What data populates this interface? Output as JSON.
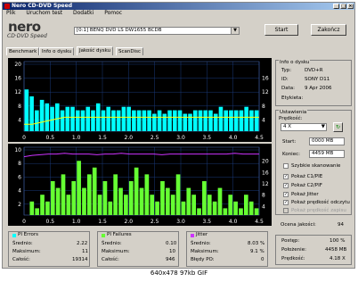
{
  "window": {
    "title": "Nero CD-DVD Speed",
    "minimize": "_",
    "maximize": "□",
    "close": "×"
  },
  "menu": [
    "Plik",
    "Uruchom test",
    "Dodatki",
    "Pomoc"
  ],
  "logo": {
    "brand": "nero",
    "product": "CD·DVD Speed"
  },
  "drive": {
    "selected": "[0:1]  BENQ DVD LS DW1655 BCDB",
    "arrow": "▼"
  },
  "buttons": {
    "start": "Start",
    "close": "Zakończ"
  },
  "tabs": [
    "Benchmark",
    "Info o dysku",
    "Jakość dysku",
    "ScanDisc"
  ],
  "chart_data": [
    {
      "type": "bar",
      "title": "",
      "x_ticks": [
        "0",
        "0.5",
        "1.0",
        "1.5",
        "2.0",
        "2.5",
        "3.0",
        "3.5",
        "4.0",
        "4.5"
      ],
      "y_ticks_left": [
        "20",
        "16",
        "12",
        "8",
        "4"
      ],
      "y_ticks_right": [
        "16",
        "12",
        "8",
        "4"
      ],
      "xlim": [
        0,
        4.5
      ],
      "ylim": [
        0,
        20
      ],
      "series": [
        {
          "name": "PI Errors",
          "color": "#00ffff",
          "style": "bars",
          "values": [
            12,
            10,
            6,
            9,
            8,
            7,
            8,
            6,
            7,
            7,
            6,
            6,
            7,
            6,
            8,
            6,
            7,
            6,
            6,
            7,
            7,
            6,
            6,
            6,
            6,
            5,
            6,
            5,
            6,
            6,
            6,
            5,
            5,
            6,
            6,
            6,
            6,
            5,
            7,
            6,
            6,
            6,
            6,
            7,
            6,
            6
          ]
        },
        {
          "name": "Read speed",
          "color": "#ffff00",
          "style": "line",
          "values": [
            2.0,
            2.0,
            2.5,
            3.0,
            3.5,
            4.0,
            4.0,
            4.0,
            4.0,
            4.0,
            4.0,
            4.0,
            4.0,
            4.0,
            4.0,
            4.0,
            4.0,
            4.0,
            4.0,
            4.0,
            4.0,
            4.0,
            4.0,
            4.0,
            4.0,
            4.0,
            4.0,
            4.0,
            4.0,
            4.0
          ]
        }
      ]
    },
    {
      "type": "bar",
      "title": "",
      "x_ticks": [
        "0",
        "0.5",
        "1.0",
        "1.5",
        "2.0",
        "2.5",
        "3.0",
        "3.5",
        "4.0",
        "4.5"
      ],
      "y_ticks_left": [
        "10",
        "8",
        "6",
        "4",
        "2"
      ],
      "y_ticks_right": [
        "20",
        "16",
        "12",
        "8",
        "4"
      ],
      "xlim": [
        0,
        4.5
      ],
      "ylim": [
        0,
        10
      ],
      "series": [
        {
          "name": "PI Failures",
          "color": "#66ff33",
          "style": "bars",
          "values": [
            0,
            2,
            1,
            3,
            2,
            5,
            4,
            6,
            3,
            5,
            8,
            4,
            6,
            7,
            3,
            5,
            2,
            6,
            4,
            3,
            5,
            7,
            4,
            6,
            3,
            2,
            5,
            4,
            3,
            6,
            2,
            4,
            3,
            1,
            5,
            3,
            2,
            4,
            1,
            3,
            2,
            1,
            3,
            2,
            1
          ]
        },
        {
          "name": "Jitter",
          "color": "#cc33ff",
          "style": "line",
          "values": [
            8.6,
            8.8,
            8.9,
            9.0,
            9.0,
            9.1,
            9.0,
            9.0,
            9.0,
            8.9,
            9.0,
            9.0,
            9.1,
            9.0,
            9.0,
            9.0,
            9.0,
            8.9,
            9.0,
            9.0,
            9.0,
            9.0,
            9.0,
            9.0,
            9.0,
            9.0,
            9.1,
            9.0,
            9.0,
            9.0
          ]
        }
      ]
    }
  ],
  "disc_info": {
    "title": "Info o dysku",
    "rows": [
      {
        "label": "Typ:",
        "value": "DVD+R"
      },
      {
        "label": "ID:",
        "value": "SONY D11"
      },
      {
        "label": "Data:",
        "value": "9 Apr 2006"
      },
      {
        "label": "Etykieta:",
        "value": ""
      }
    ]
  },
  "settings": {
    "title": "Ustawienia",
    "speed_label": "Prędkość:",
    "speed_value": "4 X",
    "refresh_icon": "↻",
    "start_label": "Start:",
    "start_value": "0000 MB",
    "end_label": "Koniec:",
    "end_value": "4459 MB",
    "checkboxes": [
      {
        "label": "Szybkie skanowanie",
        "checked": false,
        "enabled": true
      },
      {
        "label": "Pokaż C1/PIE",
        "checked": true,
        "enabled": true
      },
      {
        "label": "Pokaż C2/PIF",
        "checked": true,
        "enabled": true
      },
      {
        "label": "Pokaż Jitter",
        "checked": true,
        "enabled": true
      },
      {
        "label": "Pokaż prędkość odczytu",
        "checked": true,
        "enabled": true
      },
      {
        "label": "Pokaż prędkość zapisu",
        "checked": false,
        "enabled": false
      }
    ]
  },
  "quality": {
    "label": "Ocena jakości:",
    "value": "94"
  },
  "progress": {
    "rows": [
      {
        "label": "Postęp:",
        "value": "100 %"
      },
      {
        "label": "Położenie:",
        "value": "4458 MB"
      },
      {
        "label": "Prędkość:",
        "value": "4.18 X"
      }
    ]
  },
  "stats": {
    "pi_errors": {
      "title": "PI Errors",
      "color": "#00ffff",
      "rows": [
        {
          "label": "Średnio:",
          "value": "2.22"
        },
        {
          "label": "Maksimum:",
          "value": "11"
        },
        {
          "label": "Całość:",
          "value": "19314"
        }
      ]
    },
    "pi_failures": {
      "title": "PI Failures",
      "color": "#66ff33",
      "rows": [
        {
          "label": "Średnio:",
          "value": "0.10"
        },
        {
          "label": "Maksimum:",
          "value": "10"
        },
        {
          "label": "Całość:",
          "value": "946"
        }
      ]
    },
    "jitter": {
      "title": "Jitter",
      "color": "#cc33ff",
      "rows": [
        {
          "label": "Średnio:",
          "value": "8.03 %"
        },
        {
          "label": "Maksimum:",
          "value": "9.1 %"
        },
        {
          "label": "Błędy PO:",
          "value": "0"
        }
      ]
    }
  },
  "caption": "640x478  97kb  GIF"
}
